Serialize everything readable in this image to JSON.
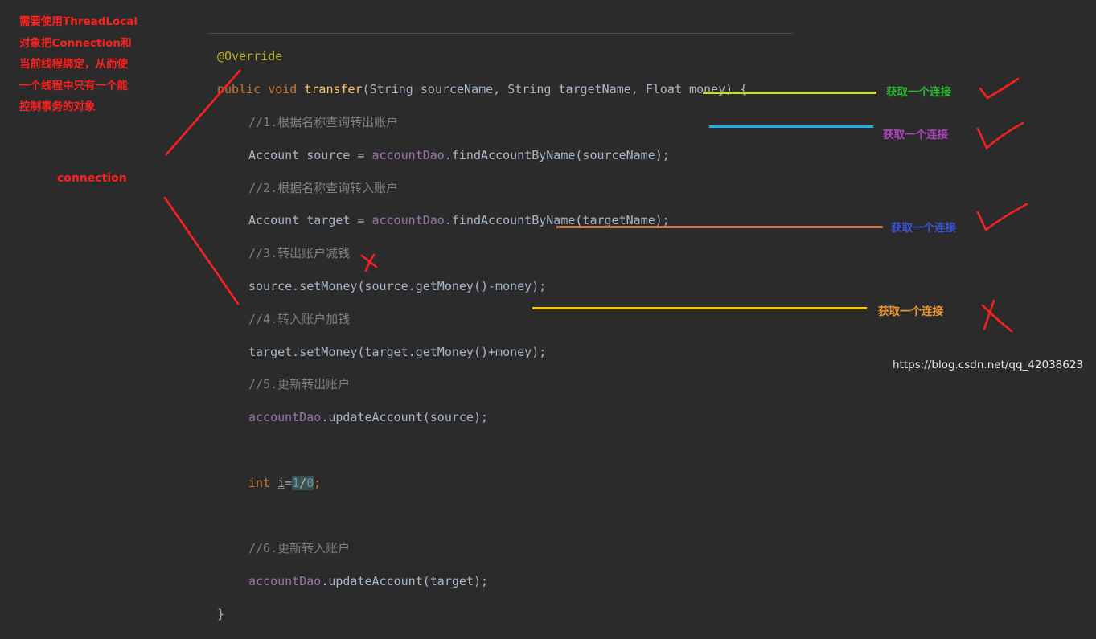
{
  "note": {
    "lines": [
      "需要使用ThreadLocal",
      "对象把Connection和",
      "当前线程绑定，从而使",
      "一个线程中只有一个能",
      "控制事务的对象"
    ],
    "connection_label": "connection"
  },
  "code": {
    "annotation": "@Override",
    "sig_public": "public",
    "sig_void": "void",
    "sig_method": "transfer",
    "sig_params": "(String sourceName, String targetName, Float money) {",
    "c1": "//1.根据名称查询转出账户",
    "l1_a": "Account source = ",
    "l1_field": "accountDao",
    "l1_b": ".findAccountByName(sourceName);",
    "c2": "//2.根据名称查询转入账户",
    "l2_a": "Account target = ",
    "l2_field": "accountDao",
    "l2_b": ".findAccountByName(targetName);",
    "c3": "//3.转出账户减钱",
    "l3": "source.setMoney(source.getMoney()-money);",
    "c4": "//4.转入账户加钱",
    "l4": "target.setMoney(target.getMoney()+money);",
    "c5": "//5.更新转出账户",
    "l5_field": "accountDao",
    "l5_b": ".updateAccount(source);",
    "l6_kw": "int",
    "l6_var": "i",
    "l6_eq": "=",
    "l6_n1": "1",
    "l6_sl": "/",
    "l6_n2": "0",
    "l6_end": ";",
    "c6": "//6.更新转入账户",
    "l7_field": "accountDao",
    "l7_b": ".updateAccount(target);",
    "close": "}"
  },
  "tags": [
    {
      "text": "获取一个连接",
      "color": "#2db834"
    },
    {
      "text": "获取一个连接",
      "color": "#b043c0"
    },
    {
      "text": "获取一个连接",
      "color": "#3a55d8"
    },
    {
      "text": "获取一个连接",
      "color": "#f0962a"
    }
  ],
  "line_colors": [
    "#bfe12a",
    "#1faee6",
    "#c07a52",
    "#f2c80f"
  ],
  "mark_color": "#ff2020",
  "watermark": "https://blog.csdn.net/qq_42038623"
}
